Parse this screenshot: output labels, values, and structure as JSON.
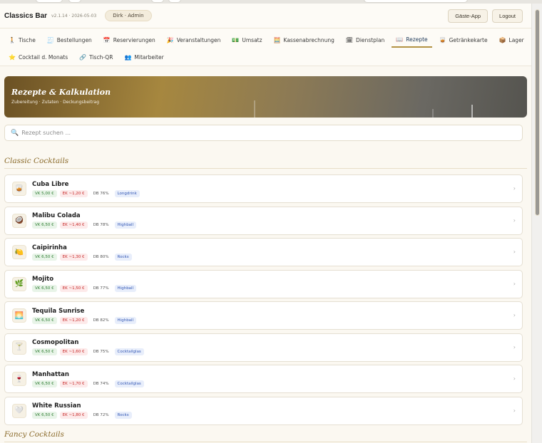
{
  "header": {
    "brand": "Classics Bar",
    "version": "v2.1.14 · 2026-05-03",
    "user": "Dirk · Admin",
    "guest_app_label": "Gäste-App",
    "logout_label": "Logout"
  },
  "nav": {
    "row1": [
      {
        "icon": "🚶",
        "label": "Tische"
      },
      {
        "icon": "🧾",
        "label": "Bestellungen"
      },
      {
        "icon": "📅",
        "label": "Reservierungen"
      },
      {
        "icon": "🎉",
        "label": "Veranstaltungen"
      },
      {
        "icon": "💵",
        "label": "Umsatz"
      },
      {
        "icon": "🧮",
        "label": "Kassenabrechnung"
      },
      {
        "icon": "🗓",
        "label": "Dienstplan"
      },
      {
        "icon": "📖",
        "label": "Rezepte",
        "active": true
      },
      {
        "icon": "🥃",
        "label": "Getränkekarte"
      },
      {
        "icon": "📦",
        "label": "Lager"
      }
    ],
    "row2": [
      {
        "icon": "⭐",
        "label": "Cocktail d. Monats"
      },
      {
        "icon": "🔗",
        "label": "Tisch-QR"
      },
      {
        "icon": "👥",
        "label": "Mitarbeiter"
      }
    ]
  },
  "hero": {
    "title": "Rezepte & Kalkulation",
    "subtitle": "Zubereitung · Zutaten · Deckungsbeitrag"
  },
  "search": {
    "placeholder": "Rezept suchen ..."
  },
  "sections": {
    "classic_title": "Classic Cocktails",
    "fancy_title": "Fancy Cocktails"
  },
  "recipes": [
    {
      "name": "Cuba Libre",
      "icon": "🥃",
      "vk": "VK 5,00 €",
      "ek": "EK ~1,20 €",
      "db": "DB 76%",
      "glass": "Longdrink"
    },
    {
      "name": "Malibu Colada",
      "icon": "🥥",
      "vk": "VK 6,50 €",
      "ek": "EK ~1,40 €",
      "db": "DB 78%",
      "glass": "Highball"
    },
    {
      "name": "Caipirinha",
      "icon": "🍋",
      "vk": "VK 6,50 €",
      "ek": "EK ~1,30 €",
      "db": "DB 80%",
      "glass": "Rocks"
    },
    {
      "name": "Mojito",
      "icon": "🌿",
      "vk": "VK 6,50 €",
      "ek": "EK ~1,50 €",
      "db": "DB 77%",
      "glass": "Highball"
    },
    {
      "name": "Tequila Sunrise",
      "icon": "🌅",
      "vk": "VK 6,50 €",
      "ek": "EK ~1,20 €",
      "db": "DB 82%",
      "glass": "Highball"
    },
    {
      "name": "Cosmopolitan",
      "icon": "🍸",
      "vk": "VK 6,50 €",
      "ek": "EK ~1,60 €",
      "db": "DB 75%",
      "glass": "Cocktailglas"
    },
    {
      "name": "Manhattan",
      "icon": "🍷",
      "vk": "VK 6,50 €",
      "ek": "EK ~1,70 €",
      "db": "DB 74%",
      "glass": "Cocktailglas"
    },
    {
      "name": "White Russian",
      "icon": "🤍",
      "vk": "VK 6,50 €",
      "ek": "EK ~1,80 €",
      "db": "DB 72%",
      "glass": "Rocks"
    }
  ]
}
